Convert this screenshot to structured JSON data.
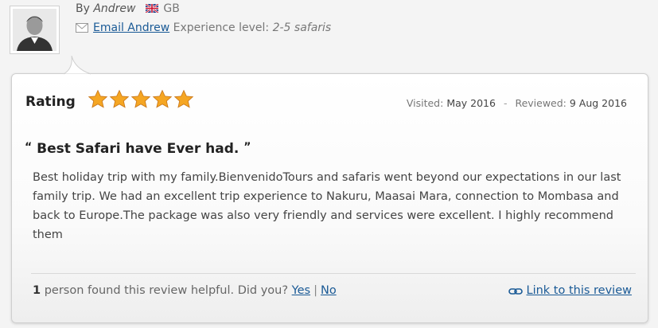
{
  "author": {
    "by_prefix": "By",
    "name": "Andrew",
    "country": "GB",
    "email_link": "Email Andrew",
    "experience_label": "Experience level:",
    "experience_value": "2-5 safaris"
  },
  "review": {
    "rating_label": "Rating",
    "rating_value": 5,
    "rating_max": 5,
    "visited_label": "Visited:",
    "visited_value": "May 2016",
    "separator": "-",
    "reviewed_label": "Reviewed:",
    "reviewed_value": "9 Aug 2016",
    "title": "Best Safari have Ever had.",
    "body": "Best holiday trip with my family.BienvenidoTours and safaris went beyond our expectations in our last family trip. We had an excellent trip experience to Nakuru, Maasai Mara, connection to Mombasa and back to Europe.The package was also very friendly and services were excellent. I highly recommend them"
  },
  "helpful": {
    "count": "1",
    "text": "person found this review helpful. Did you?",
    "yes": "Yes",
    "divider": "|",
    "no": "No"
  },
  "link_to_review": "Link to this review",
  "colors": {
    "link": "#1a5a96",
    "star": "#f5a623"
  },
  "icons": {
    "avatar": "avatar-icon",
    "flag": "uk-flag-icon",
    "mail": "envelope-icon",
    "link": "chain-link-icon",
    "star": "star-icon"
  }
}
